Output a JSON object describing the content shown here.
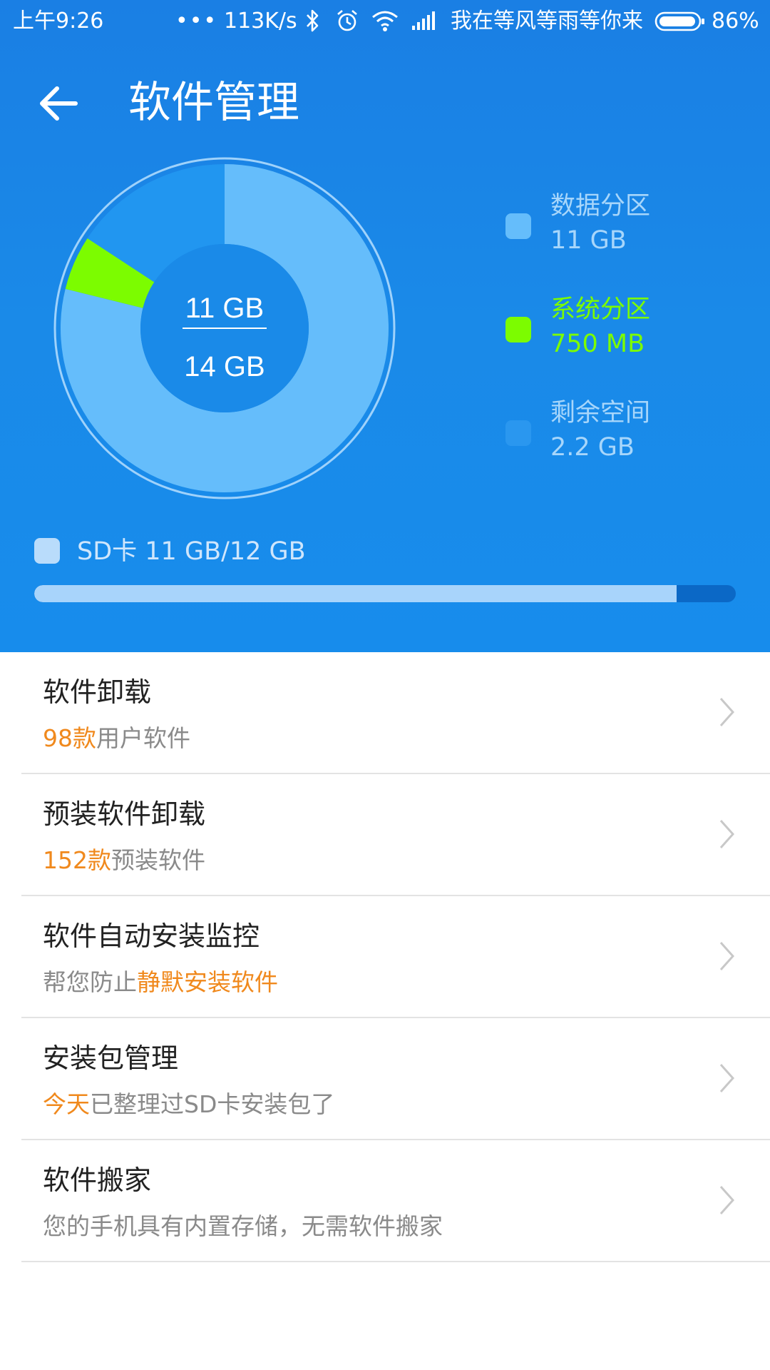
{
  "status_bar": {
    "time": "上午9:26",
    "dots": "•••",
    "speed": "113K/s",
    "carrier": "我在等风等雨等你来",
    "battery": "86%",
    "icons": [
      "bluetooth-icon",
      "alarm-icon",
      "wifi-icon",
      "signal-icon",
      "battery-icon"
    ]
  },
  "appbar": {
    "title": "软件管理",
    "back_icon": "back-arrow-icon"
  },
  "storage": {
    "center_used": "11 GB",
    "center_total": "14 GB",
    "legend": [
      {
        "label": "数据分区",
        "value": "11 GB",
        "color": "#65bdfb"
      },
      {
        "label": "系统分区",
        "value": "750 MB",
        "color": "#7cfc00"
      },
      {
        "label": "剩余空间",
        "value": "2.2 GB",
        "color": "#2196f0"
      }
    ],
    "sd_card": {
      "label": "SD卡 11 GB/12 GB",
      "used_fraction": 0.916
    }
  },
  "chart_data": {
    "type": "pie",
    "categories": [
      "数据分区",
      "系统分区",
      "剩余空间"
    ],
    "values": [
      11,
      0.75,
      2.2
    ],
    "colors": [
      "#65bdfb",
      "#7cfc00",
      "#2196f0"
    ],
    "start_angle_deg": 0
  },
  "menu": [
    {
      "title": "软件卸载",
      "sub_highlight": "98款",
      "sub_rest": "用户软件",
      "highlight_first": true
    },
    {
      "title": "预装软件卸载",
      "sub_highlight": "152款",
      "sub_rest": "预装软件",
      "highlight_first": true
    },
    {
      "title": "软件自动安装监控",
      "sub_highlight": "静默安装软件",
      "sub_rest": "帮您防止",
      "highlight_first": false
    },
    {
      "title": "安装包管理",
      "sub_highlight": "今天",
      "sub_rest": "已整理过SD卡安装包了",
      "highlight_first": true
    },
    {
      "title": "软件搬家",
      "sub_highlight": "",
      "sub_rest": "您的手机具有内置存储，无需软件搬家",
      "highlight_first": true
    }
  ],
  "colors": {
    "header_bg": "#1a87e8",
    "highlight": "#f0891d",
    "chevron": "#c8c8c8"
  }
}
